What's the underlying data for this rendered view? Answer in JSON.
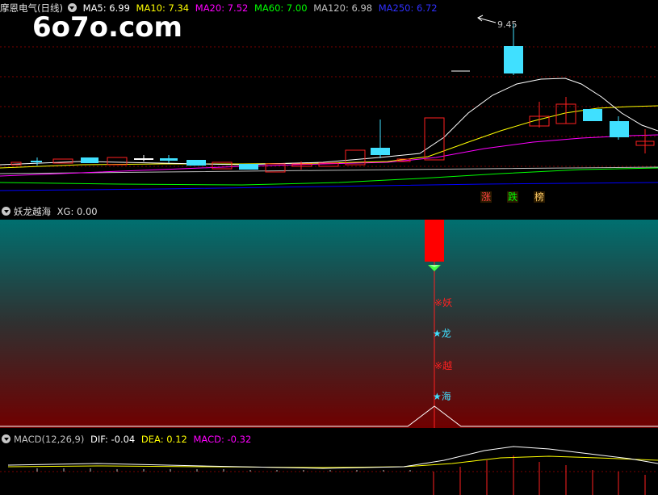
{
  "watermark": "6o7o.com",
  "price_panel": {
    "stock_title": "摩恩电气(日线)",
    "ma_labels": [
      {
        "text": "MA5: 6.99",
        "color": "#ffffff"
      },
      {
        "text": "MA10: 7.34",
        "color": "#ffff00"
      },
      {
        "text": "MA20: 7.52",
        "color": "#ff00ff"
      },
      {
        "text": "MA60: 7.00",
        "color": "#00ff00"
      },
      {
        "text": "MA120: 6.98",
        "color": "#c0c0c0"
      },
      {
        "text": "MA250: 6.72",
        "color": "#0000ff"
      }
    ],
    "high_label": "9.45",
    "tags": [
      {
        "text": "涨",
        "color": "#ff4040"
      },
      {
        "text": "跌",
        "color": "#00ff00"
      },
      {
        "text": "榜",
        "color": "#ffcc66"
      }
    ]
  },
  "indicator_panel": {
    "title": "妖龙越海",
    "value_label": "XG: 0.00",
    "markers": [
      {
        "symbol": "※",
        "text": "妖",
        "color": "#ff2020"
      },
      {
        "symbol": "★",
        "text": "龙",
        "color": "#40e0ff"
      },
      {
        "symbol": "※",
        "text": "越",
        "color": "#ff2020"
      },
      {
        "symbol": "★",
        "text": "海",
        "color": "#40e0ff"
      }
    ]
  },
  "macd_panel": {
    "title": "MACD(12,26,9)",
    "dif": "DIF: -0.04",
    "dea": "DEA: 0.12",
    "macd": "MACD: -0.32",
    "colors": {
      "title": "#c0c0c0",
      "dif": "#ffffff",
      "dea": "#ffff00",
      "macd": "#ff00ff"
    }
  }
}
